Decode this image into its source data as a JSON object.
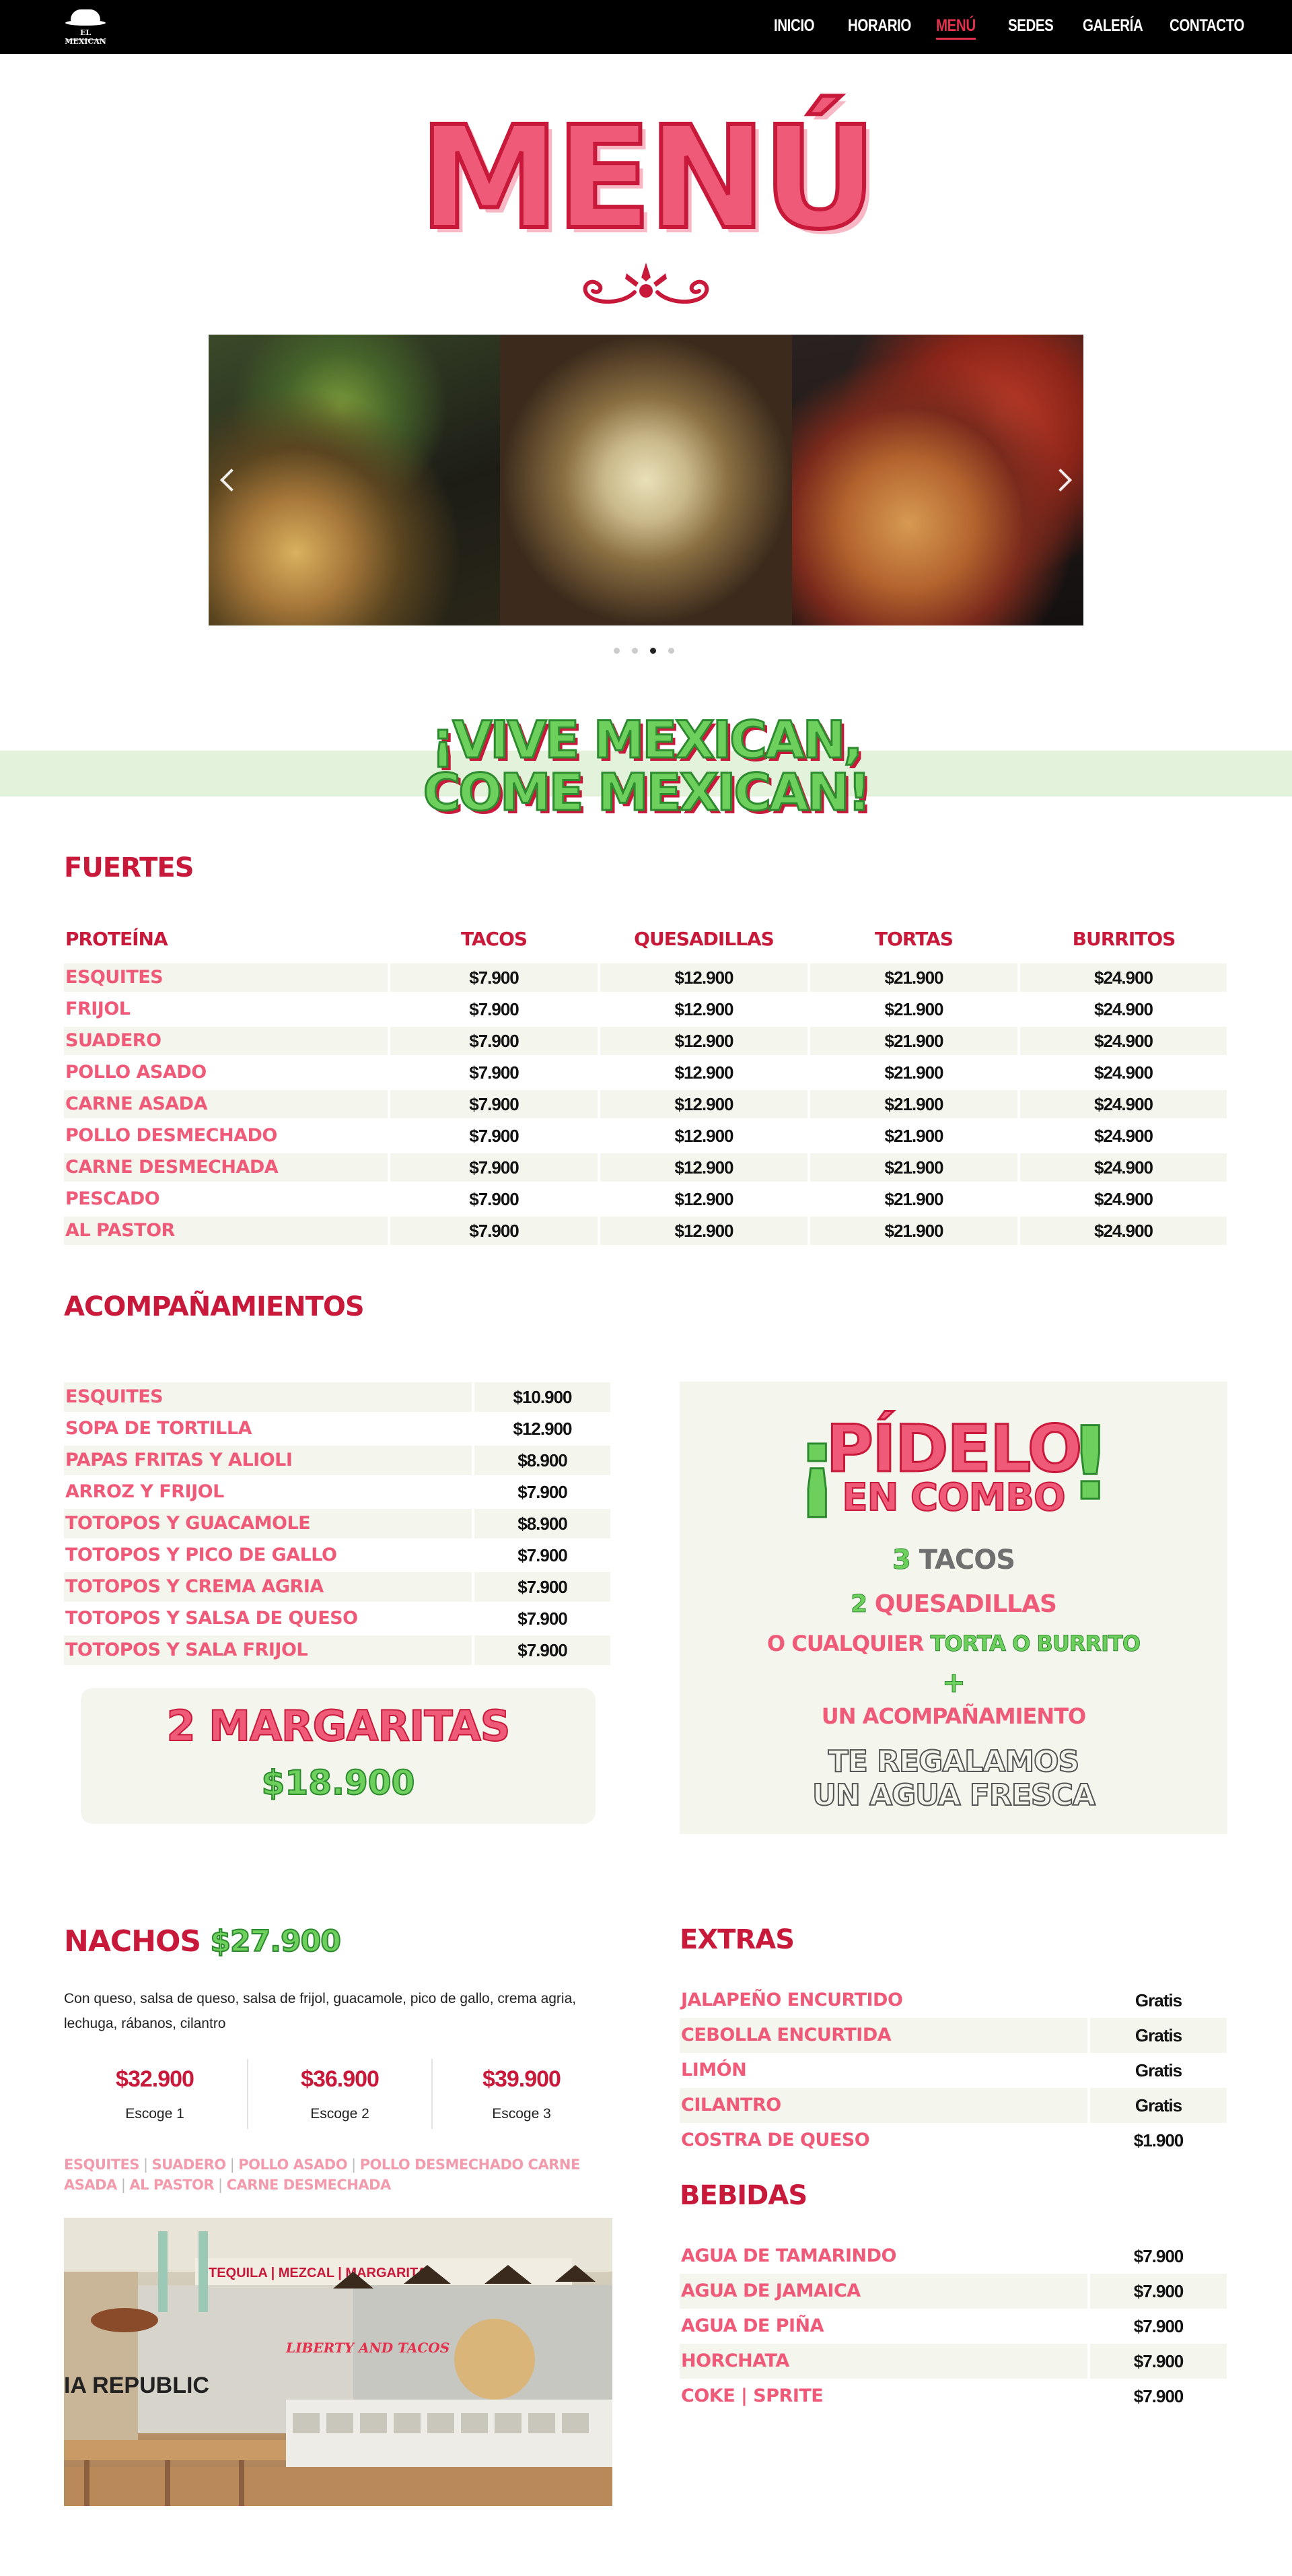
{
  "nav": {
    "logo_text": "EL MEXICAN",
    "items": [
      "INICIO",
      "HORARIO",
      "MENÚ",
      "SEDES",
      "GALERÍA",
      "CONTACTO"
    ],
    "active": "MENÚ"
  },
  "hero": {
    "title": "MENÚ"
  },
  "carousel": {
    "slides": [
      "nachos-photo",
      "quesadilla-photo",
      "tacos-photo"
    ],
    "dot_count": 4,
    "active_dot": 3
  },
  "slogan": {
    "line1": "¡VIVE MEXICAN,",
    "line2": "COME MEXICAN!"
  },
  "fuertes": {
    "title": "FUERTES",
    "headers": [
      "PROTEÍNA",
      "TACOS",
      "QUESADILLAS",
      "TORTAS",
      "BURRITOS"
    ],
    "rows": [
      {
        "name": "ESQUITES",
        "prices": [
          "$7.900",
          "$12.900",
          "$21.900",
          "$24.900"
        ]
      },
      {
        "name": "FRIJOL",
        "prices": [
          "$7.900",
          "$12.900",
          "$21.900",
          "$24.900"
        ]
      },
      {
        "name": "SUADERO",
        "prices": [
          "$7.900",
          "$12.900",
          "$21.900",
          "$24.900"
        ]
      },
      {
        "name": "POLLO ASADO",
        "prices": [
          "$7.900",
          "$12.900",
          "$21.900",
          "$24.900"
        ]
      },
      {
        "name": "CARNE ASADA",
        "prices": [
          "$7.900",
          "$12.900",
          "$21.900",
          "$24.900"
        ]
      },
      {
        "name": "POLLO DESMECHADO",
        "prices": [
          "$7.900",
          "$12.900",
          "$21.900",
          "$24.900"
        ]
      },
      {
        "name": "CARNE DESMECHADA",
        "prices": [
          "$7.900",
          "$12.900",
          "$21.900",
          "$24.900"
        ]
      },
      {
        "name": "PESCADO",
        "prices": [
          "$7.900",
          "$12.900",
          "$21.900",
          "$24.900"
        ]
      },
      {
        "name": "AL PASTOR",
        "prices": [
          "$7.900",
          "$12.900",
          "$21.900",
          "$24.900"
        ]
      }
    ]
  },
  "acompanamientos": {
    "title": "ACOMPAÑAMIENTOS",
    "rows": [
      {
        "name": "ESQUITES",
        "price": "$10.900"
      },
      {
        "name": "SOPA DE TORTILLA",
        "price": "$12.900"
      },
      {
        "name": "PAPAS FRITAS Y ALIOLI",
        "price": "$8.900"
      },
      {
        "name": "ARROZ Y FRIJOL",
        "price": "$7.900"
      },
      {
        "name": "TOTOPOS Y GUACAMOLE",
        "price": "$8.900"
      },
      {
        "name": "TOTOPOS Y PICO DE GALLO",
        "price": "$7.900"
      },
      {
        "name": "TOTOPOS Y CREMA AGRIA",
        "price": "$7.900"
      },
      {
        "name": "TOTOPOS Y SALSA DE QUESO",
        "price": "$7.900"
      },
      {
        "name": "TOTOPOS Y SALA FRIJOL",
        "price": "$7.900"
      }
    ]
  },
  "margaritas": {
    "title": "2 MARGARITAS",
    "price": "$18.900"
  },
  "combo": {
    "open": "¡",
    "title": "PÍDELO",
    "subtitle": "EN COMBO",
    "close": "!",
    "l1_num": "3",
    "l1_text": "TACOS",
    "l2_num": "2",
    "l2_text": "QUESADILLAS",
    "l3_a": "O CUALQUIER",
    "l3_b": "TORTA O BURRITO",
    "plus": "+",
    "l4": "UN ACOMPAÑAMIENTO",
    "gift_line1": "TE REGALAMOS",
    "gift_line2": "UN AGUA FRESCA"
  },
  "nachos": {
    "title": "NACHOS",
    "price": "$27.900",
    "description": "Con queso, salsa de queso, salsa de frijol, guacamole, pico de gallo, crema agria, lechuga, rábanos, cilantro",
    "choices": [
      {
        "price": "$32.900",
        "label": "Escoge 1"
      },
      {
        "price": "$36.900",
        "label": "Escoge 2"
      },
      {
        "price": "$39.900",
        "label": "Escoge 3"
      }
    ],
    "options": [
      "ESQUITES",
      "SUADERO",
      "POLLO ASADO",
      "POLLO DESMECHADO CARNE ASADA",
      "AL PASTOR",
      "CARNE DESMECHADA"
    ],
    "photo_sign_1": "IA REPUBLIC",
    "photo_sign_2": "LIBERTY AND TACOS",
    "photo_banner": "TEQUILA | MEZCAL | MARGARITA"
  },
  "extras": {
    "title": "EXTRAS",
    "rows": [
      {
        "name": "JALAPEÑO ENCURTIDO",
        "price": "Gratis"
      },
      {
        "name": "CEBOLLA ENCURTIDA",
        "price": "Gratis"
      },
      {
        "name": "LIMÓN",
        "price": "Gratis"
      },
      {
        "name": "CILANTRO",
        "price": "Gratis"
      },
      {
        "name": "COSTRA DE QUESO",
        "price": "$1.900"
      }
    ]
  },
  "bebidas": {
    "title": "BEBIDAS",
    "rows": [
      {
        "name": "AGUA DE TAMARINDO",
        "price": "$7.900"
      },
      {
        "name": "AGUA DE JAMAICA",
        "price": "$7.900"
      },
      {
        "name": "AGUA DE PIÑA",
        "price": "$7.900"
      },
      {
        "name": "HORCHATA",
        "price": "$7.900"
      },
      {
        "name": "COKE | SPRITE",
        "price": "$7.900"
      }
    ]
  },
  "colors": {
    "brand_red": "#c8193a",
    "brand_pink": "#ef5a79",
    "brand_green": "#6dd05c",
    "row_tint": "#f4f5ec",
    "nav_bg": "#000000"
  }
}
